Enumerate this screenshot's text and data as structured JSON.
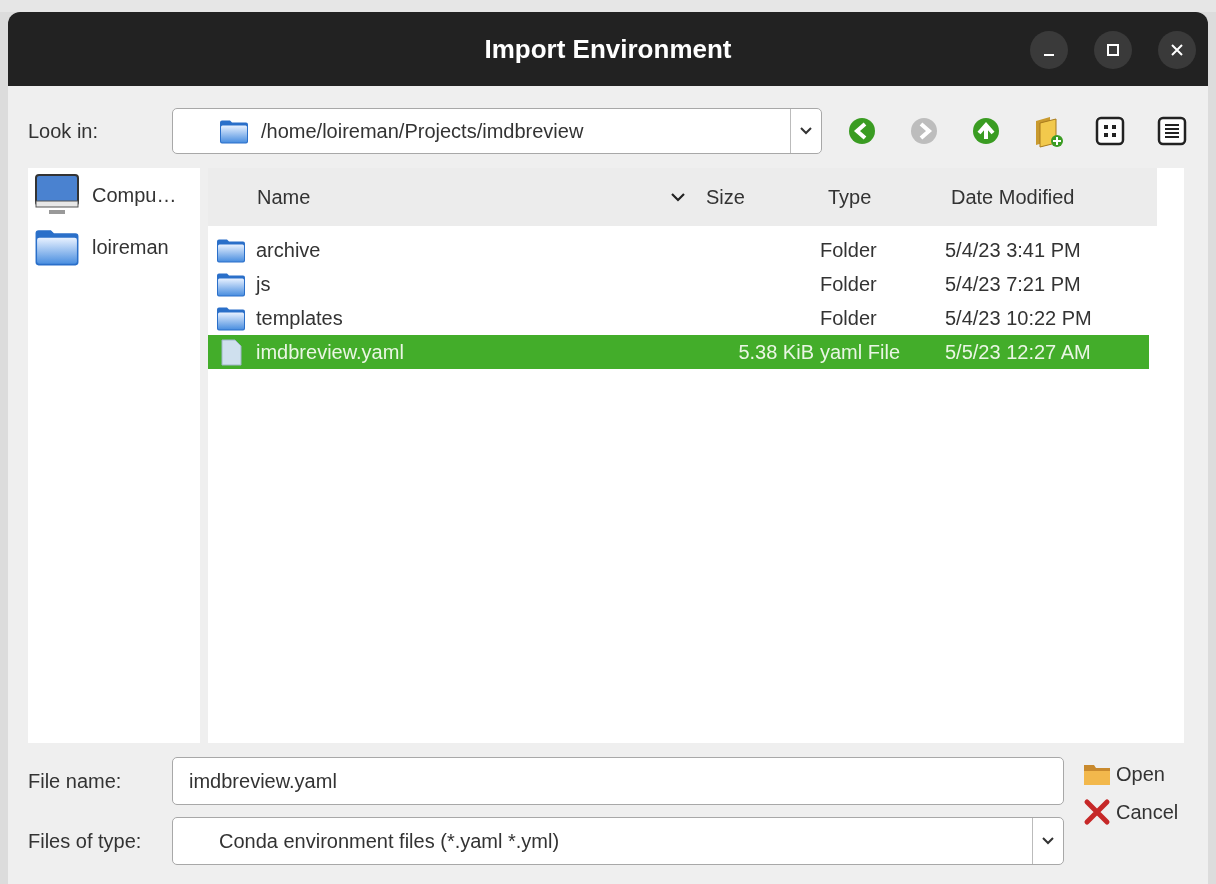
{
  "window": {
    "title": "Import Environment"
  },
  "look_in": {
    "label": "Look in:",
    "path": "/home/loireman/Projects/imdbreview"
  },
  "toolbar": [
    {
      "kind": "back",
      "disabled": false
    },
    {
      "kind": "forward",
      "disabled": true
    },
    {
      "kind": "up",
      "disabled": false
    },
    {
      "kind": "new-folder"
    },
    {
      "kind": "icon-view"
    },
    {
      "kind": "detail-view"
    }
  ],
  "sidebar": {
    "items": [
      {
        "label": "Compu…",
        "kind": "computer"
      },
      {
        "label": "loireman",
        "kind": "folder"
      }
    ]
  },
  "table": {
    "columns": [
      {
        "label": "Name",
        "sorted": true
      },
      {
        "label": "Size",
        "sorted": false
      },
      {
        "label": "Type",
        "sorted": false
      },
      {
        "label": "Date Modified",
        "sorted": false
      }
    ],
    "rows": [
      {
        "kind": "folder",
        "name": "archive",
        "size": "",
        "type": "Folder",
        "date": "5/4/23 3:41 PM",
        "selected": false
      },
      {
        "kind": "folder",
        "name": "js",
        "size": "",
        "type": "Folder",
        "date": "5/4/23 7:21 PM",
        "selected": false
      },
      {
        "kind": "folder",
        "name": "templates",
        "size": "",
        "type": "Folder",
        "date": "5/4/23 10:22 PM",
        "selected": false
      },
      {
        "kind": "file",
        "name": "imdbreview.yaml",
        "size": "5.38 KiB",
        "type": "yaml File",
        "date": "5/5/23 12:27 AM",
        "selected": true
      }
    ]
  },
  "file_name": {
    "label": "File name:",
    "value": "imdbreview.yaml"
  },
  "file_type": {
    "label": "Files of type:",
    "value": "Conda environment files (*.yaml *.yml)"
  },
  "buttons": [
    {
      "kind": "open",
      "label": "Open"
    },
    {
      "kind": "cancel",
      "label": "Cancel"
    }
  ]
}
